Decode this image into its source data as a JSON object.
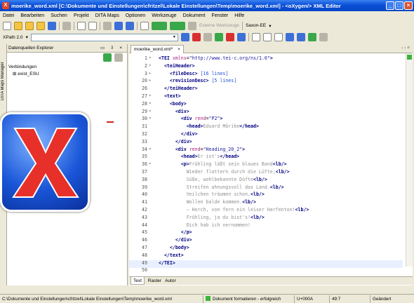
{
  "window": {
    "title": "moerike_word.xml [C:\\Dokumente und Einstellungen\\cfritzel\\Lokale Einstellungen\\Temp\\moerike_word.xml] - <oXygen/> XML Editor"
  },
  "menu": [
    "Datei",
    "Bearbeiten",
    "Suchen",
    "Projekt",
    "DITA Maps",
    "Optionen",
    "Werkzeuge",
    "Dokument",
    "Fenster",
    "Hilfe"
  ],
  "toolbar": {
    "external_tools": "Externe Werkzeuge",
    "transform": "Saxon-EE"
  },
  "xpath": {
    "label": "XPath 2.0",
    "value": ""
  },
  "left_panel": {
    "title": "Datenquellen Explorer",
    "side_tab": "DITA Maps Manager",
    "tree": {
      "root": "Verbindungen",
      "child": "exist_ESU"
    }
  },
  "editor": {
    "tab_label": "moerike_word.xml*",
    "lines": [
      {
        "n": "1",
        "fold": "▾",
        "html": "<span class=\"tg\">&lt;TEI</span> <span class=\"an\">xmlns</span>=<span class=\"av\">\"http://www.tei-c.org/ns/1.0\"</span><span class=\"tg\">&gt;</span>"
      },
      {
        "n": "2",
        "fold": "▾",
        "html": "  <span class=\"tg\">&lt;teiHeader&gt;</span>"
      },
      {
        "n": "3",
        "fold": "▸",
        "html": "    <span class=\"tg\">&lt;fileDesc&gt;</span> <span class=\"ell\">[16 lines]</span>"
      },
      {
        "n": "20",
        "fold": "▸",
        "html": "    <span class=\"tg\">&lt;revisionDesc&gt;</span> <span class=\"ell\">[5 lines]</span>"
      },
      {
        "n": "26",
        "fold": "",
        "html": "  <span class=\"tg\">&lt;/teiHeader&gt;</span>"
      },
      {
        "n": "27",
        "fold": "▾",
        "html": "  <span class=\"tg\">&lt;text&gt;</span>"
      },
      {
        "n": "28",
        "fold": "▾",
        "html": "    <span class=\"tg\">&lt;body&gt;</span>"
      },
      {
        "n": "29",
        "fold": "▾",
        "html": "      <span class=\"tg\">&lt;div&gt;</span>"
      },
      {
        "n": "30",
        "fold": "▾",
        "html": "        <span class=\"tg\">&lt;div</span> <span class=\"an\">rend</span>=<span class=\"av\">\"P2\"</span><span class=\"tg\">&gt;</span>"
      },
      {
        "n": "31",
        "fold": "",
        "html": "          <span class=\"tg\">&lt;head&gt;</span><span class=\"tx\">Eduard Mörike</span><span class=\"tg\">&lt;/head&gt;</span>"
      },
      {
        "n": "32",
        "fold": "",
        "html": "        <span class=\"tg\">&lt;/div&gt;</span>"
      },
      {
        "n": "33",
        "fold": "",
        "html": "      <span class=\"tg\">&lt;/div&gt;</span>"
      },
      {
        "n": "34",
        "fold": "▾",
        "html": "      <span class=\"tg\">&lt;div</span> <span class=\"an\">rend</span>=<span class=\"av\">\"Heading_20_2\"</span><span class=\"tg\">&gt;</span>"
      },
      {
        "n": "35",
        "fold": "",
        "html": "        <span class=\"tg\">&lt;head&gt;</span><span class=\"tx\">Er ist's</span><span class=\"tg\">&lt;/head&gt;</span>"
      },
      {
        "n": "36",
        "fold": "▾",
        "html": "        <span class=\"tg\">&lt;p&gt;</span><span class=\"tx\">Frühling läßt sein blaues Band</span><span class=\"tg\">&lt;lb/&gt;</span>"
      },
      {
        "n": "37",
        "fold": "",
        "html": "          <span class=\"tx\">Wieder flattern durch die Lüfte;</span><span class=\"tg\">&lt;lb/&gt;</span>"
      },
      {
        "n": "38",
        "fold": "",
        "html": "          <span class=\"tx\">Süße, wohlbekannte Düfte</span><span class=\"tg\">&lt;lb/&gt;</span>"
      },
      {
        "n": "39",
        "fold": "",
        "html": "          <span class=\"tx\">Streifen ahnungsvoll das Land.</span><span class=\"tg\">&lt;lb/&gt;</span>"
      },
      {
        "n": "40",
        "fold": "",
        "html": "          <span class=\"tx\">Veilchen träumen schon,</span><span class=\"tg\">&lt;lb/&gt;</span>"
      },
      {
        "n": "41",
        "fold": "",
        "html": "          <span class=\"tx\">Wollen balde kommen.</span><span class=\"tg\">&lt;lb/&gt;</span>"
      },
      {
        "n": "42",
        "fold": "",
        "html": "          <span class=\"tx\">– Horch, von fern ein leiser Harfenton!</span><span class=\"tg\">&lt;lb/&gt;</span>"
      },
      {
        "n": "43",
        "fold": "",
        "html": "          <span class=\"tx\">Frühling, ja du bist's!</span><span class=\"tg\">&lt;lb/&gt;</span>"
      },
      {
        "n": "44",
        "fold": "",
        "html": "          <span class=\"tx\">Dich hab ich vernommen!</span>"
      },
      {
        "n": "45",
        "fold": "",
        "html": "        <span class=\"tg\">&lt;/p&gt;</span>"
      },
      {
        "n": "46",
        "fold": "",
        "html": "      <span class=\"tg\">&lt;/div&gt;</span>"
      },
      {
        "n": "47",
        "fold": "",
        "html": "    <span class=\"tg\">&lt;/body&gt;</span>"
      },
      {
        "n": "48",
        "fold": "",
        "html": "  <span class=\"tg\">&lt;/text&gt;</span>"
      },
      {
        "n": "49",
        "fold": "",
        "html": "<span class=\"tg\">&lt;/TEI&gt;</span>"
      },
      {
        "n": "50",
        "fold": "",
        "html": ""
      }
    ],
    "bottom_tabs": [
      "Text",
      "Raster",
      "Autor"
    ]
  },
  "status": {
    "path": "C:\\Dokumente und Einstellungen\\cfritzel\\Lokale Einstellungen\\Temp\\moerike_word.xml",
    "message": "Dokument formatieren - erfolgreich",
    "unicode": "U+000A",
    "position": "49:7",
    "modified": "Geändert"
  },
  "colors": {
    "titlebar": "#0a4fd8",
    "tag": "#000080",
    "attr_name": "#b02080",
    "attr_value": "#1a1aa0",
    "text": "#909090"
  }
}
